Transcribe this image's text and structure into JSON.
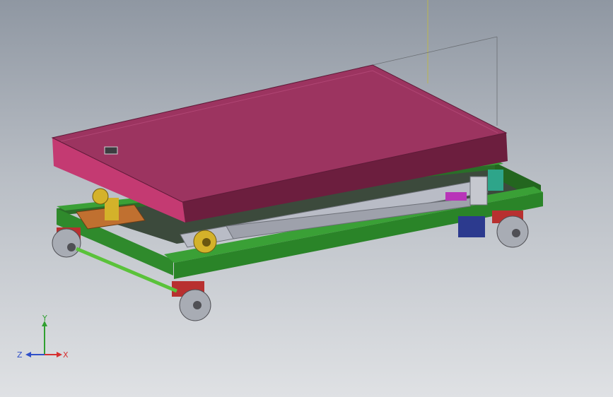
{
  "viewport": {
    "background_top": "#8f97a2",
    "background_bottom": "#dfe1e4"
  },
  "model": {
    "components": [
      "platform-top",
      "scissor-arms",
      "base-frame",
      "casters",
      "hydraulic-cylinder",
      "pump-motor",
      "tow-bar"
    ],
    "colors": {
      "platform": "#9c3460",
      "frame": "#2e8a2c",
      "scissor": "#b9bcc6",
      "brackets": "#c07030",
      "wheel_mounts": "#b83030",
      "cylinder": "#d4b22a",
      "motor": "#2c3a8e",
      "tow_bar": "#5ac23a"
    }
  },
  "triad": {
    "x_label": "X",
    "y_label": "Y",
    "z_label": "Z",
    "x_color": "#d63030",
    "y_color": "#30a030",
    "z_color": "#3050c8"
  }
}
